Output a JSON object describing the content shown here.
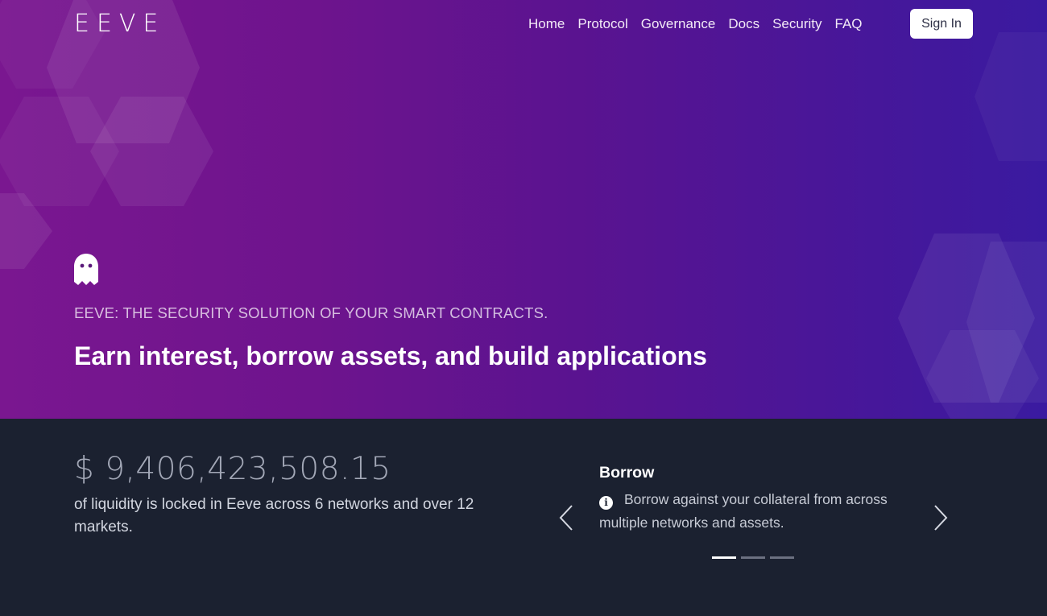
{
  "brand": {
    "logo_text": "EEVE"
  },
  "nav": {
    "items": [
      {
        "label": "Home"
      },
      {
        "label": "Protocol"
      },
      {
        "label": "Governance"
      },
      {
        "label": "Docs"
      },
      {
        "label": "Security"
      },
      {
        "label": "FAQ"
      }
    ],
    "signin_label": "Sign In"
  },
  "hero": {
    "icon": "ghost-icon",
    "tagline": "EEVE: THE SECURITY SOLUTION OF YOUR SMART CONTRACTS.",
    "headline": "Earn interest, borrow assets, and build applications"
  },
  "stats": {
    "amount": "$ 9,406,423,508.15",
    "description": "of liquidity is locked in Eeve across 6 networks and over 12 markets."
  },
  "carousel": {
    "slide_title": "Borrow",
    "slide_body": "Borrow against your collateral from across multiple networks and assets.",
    "info_icon_glyph": "i",
    "active_index": 0,
    "slide_count": 3
  },
  "colors": {
    "hero_gradient_start": "#7a1790",
    "hero_gradient_end": "#3a1aa0",
    "dark_background": "#1b2130",
    "amount_text": "#a3a8b7"
  }
}
